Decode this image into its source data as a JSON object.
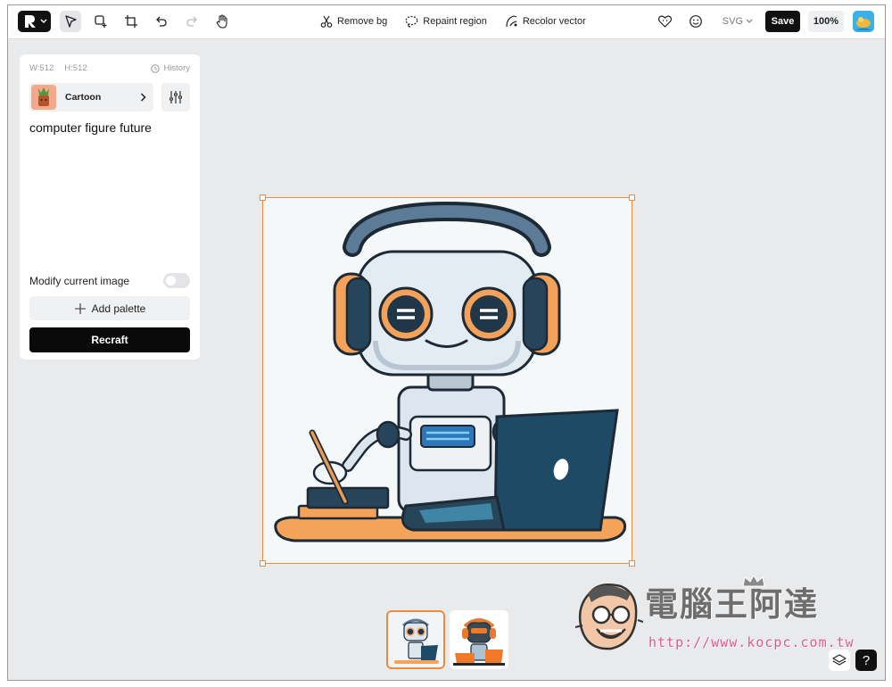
{
  "toolbar": {
    "center_tools": [
      {
        "label": "Remove bg",
        "icon": "scissors-icon"
      },
      {
        "label": "Repaint region",
        "icon": "lasso-icon"
      },
      {
        "label": "Recolor vector",
        "icon": "recolor-icon"
      }
    ],
    "format": "SVG",
    "save_label": "Save",
    "zoom": "100%"
  },
  "panel": {
    "width_label": "W:512",
    "height_label": "H:512",
    "history_label": "History",
    "style_label": "Cartoon",
    "prompt": "computer figure future",
    "modify_label": "Modify current image",
    "modify_enabled": false,
    "add_palette_label": "Add palette",
    "recraft_label": "Recraft"
  },
  "colors": {
    "accent": "#f08a3c",
    "dark": "#0a0a0a",
    "canvas_bg": "#e9eaec",
    "watermark_url": "#e25a8a"
  },
  "watermark": {
    "title": "電腦王阿達",
    "url": "http://www.kocpc.com.tw"
  },
  "help_label": "?"
}
